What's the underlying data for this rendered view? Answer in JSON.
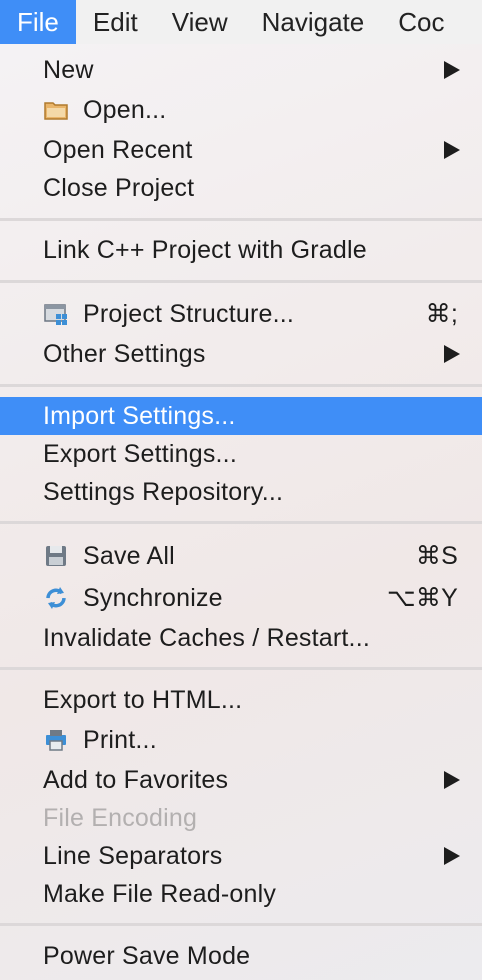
{
  "menubar": {
    "items": [
      {
        "label": "File",
        "active": true
      },
      {
        "label": "Edit"
      },
      {
        "label": "View"
      },
      {
        "label": "Navigate"
      },
      {
        "label": "Coc"
      }
    ]
  },
  "menu": {
    "new": {
      "label": "New",
      "submenu": true
    },
    "open": {
      "label": "Open...",
      "icon": "folder-icon"
    },
    "open_recent": {
      "label": "Open Recent",
      "submenu": true
    },
    "close_project": {
      "label": "Close Project"
    },
    "link_cpp": {
      "label": "Link C++ Project with Gradle"
    },
    "project_structure": {
      "label": "Project Structure...",
      "shortcut": "⌘;",
      "icon": "project-structure-icon"
    },
    "other_settings": {
      "label": "Other Settings",
      "submenu": true
    },
    "import_settings": {
      "label": "Import Settings...",
      "highlighted": true
    },
    "export_settings": {
      "label": "Export Settings..."
    },
    "settings_repository": {
      "label": "Settings Repository..."
    },
    "save_all": {
      "label": "Save All",
      "shortcut": "⌘S",
      "icon": "floppy-disk-icon"
    },
    "synchronize": {
      "label": "Synchronize",
      "shortcut": "⌥⌘Y",
      "icon": "sync-icon"
    },
    "invalidate_caches": {
      "label": "Invalidate Caches / Restart..."
    },
    "export_html": {
      "label": "Export to HTML..."
    },
    "print": {
      "label": "Print...",
      "icon": "printer-icon"
    },
    "add_favorites": {
      "label": "Add to Favorites",
      "submenu": true
    },
    "file_encoding": {
      "label": "File Encoding",
      "disabled": true
    },
    "line_separators": {
      "label": "Line Separators",
      "submenu": true
    },
    "make_readonly": {
      "label": "Make File Read-only"
    },
    "power_save": {
      "label": "Power Save Mode"
    }
  },
  "colors": {
    "highlight": "#3f8ef7",
    "disabled_text": "#b3b0b0",
    "icon_blue": "#3d8fd6"
  }
}
